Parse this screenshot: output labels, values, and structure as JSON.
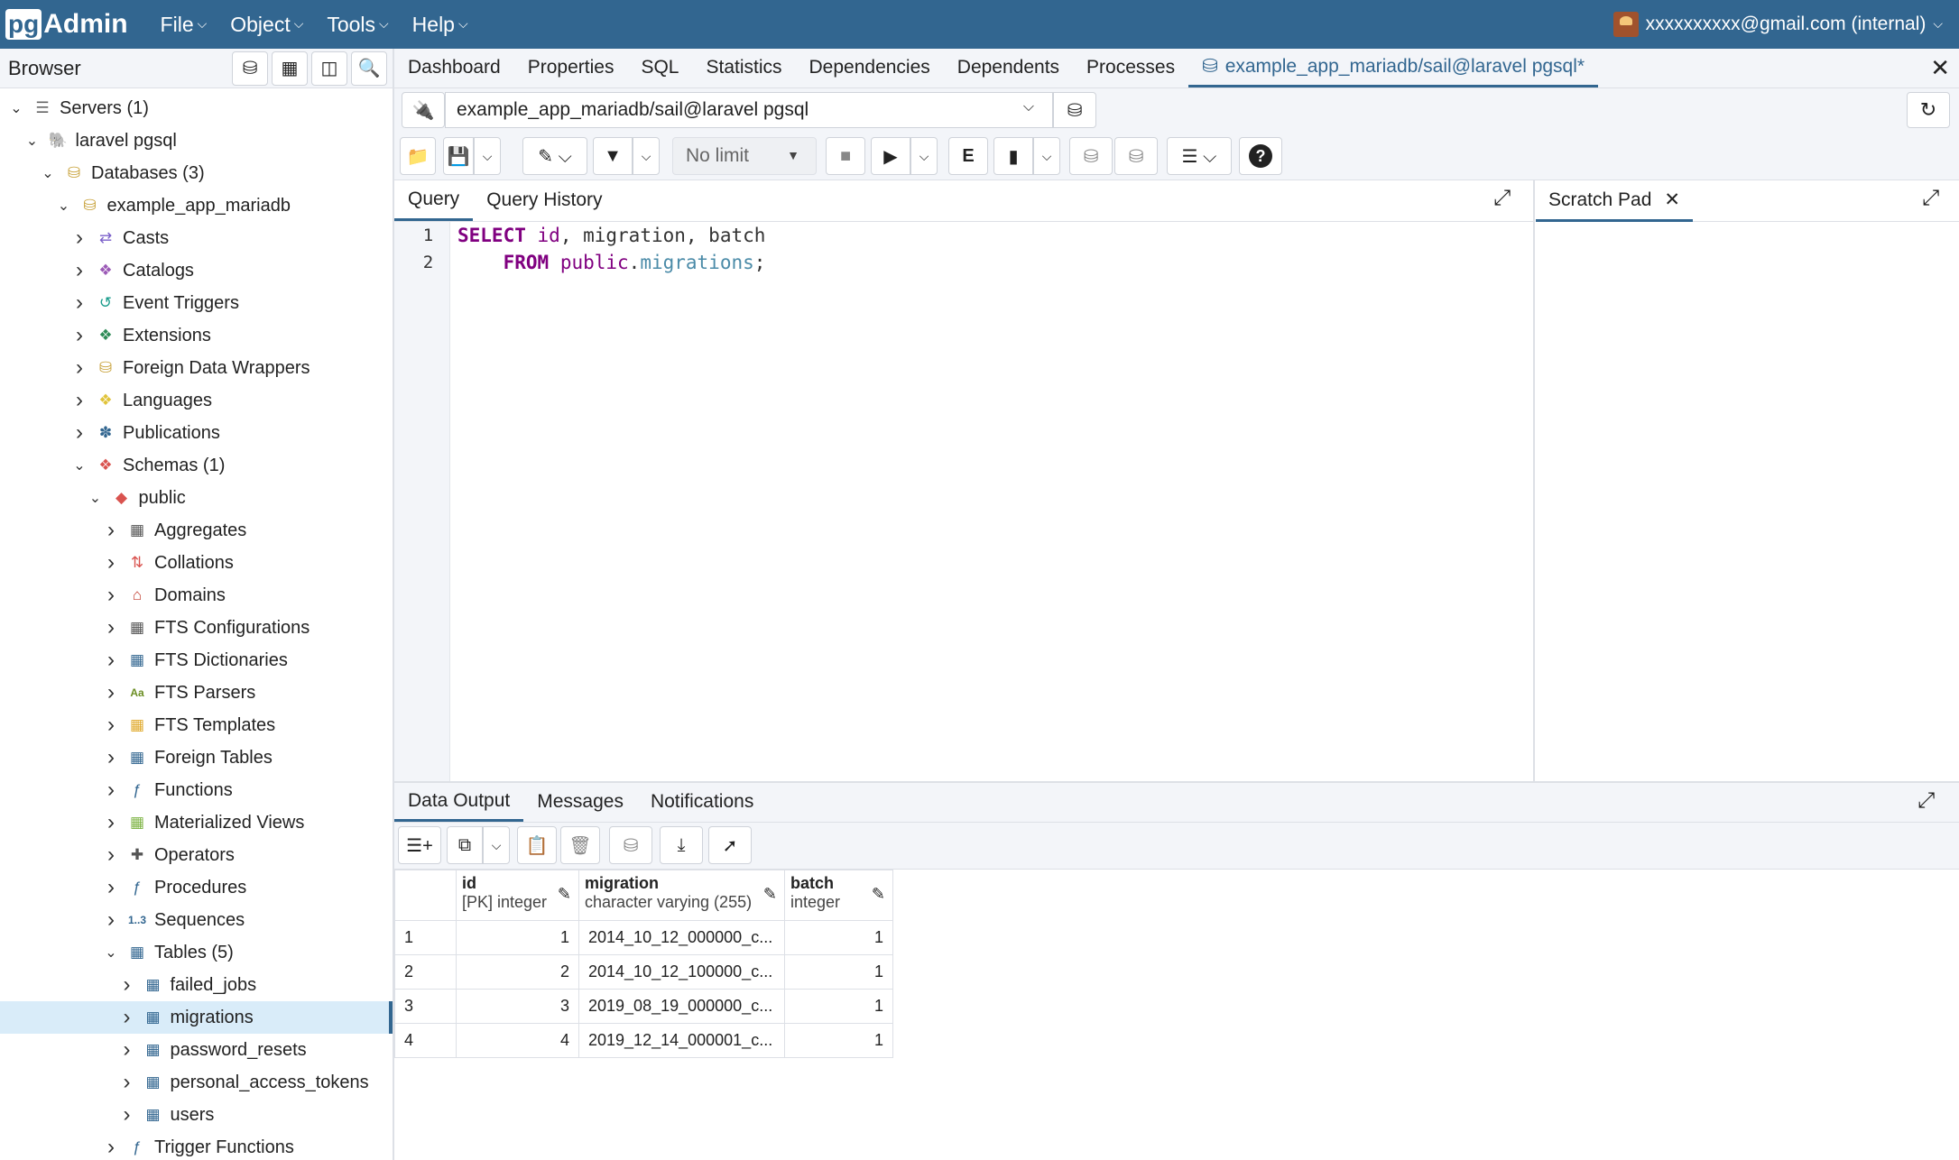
{
  "app": {
    "logo_pg": "pg",
    "logo_admin": "Admin",
    "menu": [
      {
        "label": "File"
      },
      {
        "label": "Object"
      },
      {
        "label": "Tools"
      },
      {
        "label": "Help"
      }
    ],
    "user": "xxxxxxxxxx@gmail.com (internal)"
  },
  "browser": {
    "title": "Browser",
    "tree": [
      {
        "label": "Servers (1)",
        "depth": 0,
        "toggle": "down",
        "icon": "servers-icon"
      },
      {
        "label": "laravel pgsql",
        "depth": 1,
        "toggle": "down",
        "icon": "elephant-icon"
      },
      {
        "label": "Databases (3)",
        "depth": 2,
        "toggle": "down",
        "icon": "databases-icon"
      },
      {
        "label": "example_app_mariadb",
        "depth": 3,
        "toggle": "down",
        "icon": "database-icon"
      },
      {
        "label": "Casts",
        "depth": 4,
        "toggle": "right",
        "icon": "casts-icon"
      },
      {
        "label": "Catalogs",
        "depth": 4,
        "toggle": "right",
        "icon": "catalogs-icon"
      },
      {
        "label": "Event Triggers",
        "depth": 4,
        "toggle": "right",
        "icon": "event-triggers-icon"
      },
      {
        "label": "Extensions",
        "depth": 4,
        "toggle": "right",
        "icon": "extensions-icon"
      },
      {
        "label": "Foreign Data Wrappers",
        "depth": 4,
        "toggle": "right",
        "icon": "fdw-icon"
      },
      {
        "label": "Languages",
        "depth": 4,
        "toggle": "right",
        "icon": "languages-icon"
      },
      {
        "label": "Publications",
        "depth": 4,
        "toggle": "right",
        "icon": "publications-icon"
      },
      {
        "label": "Schemas (1)",
        "depth": 4,
        "toggle": "down",
        "icon": "schemas-icon"
      },
      {
        "label": "public",
        "depth": 5,
        "toggle": "down",
        "icon": "schema-icon"
      },
      {
        "label": "Aggregates",
        "depth": 6,
        "toggle": "right",
        "icon": "aggregates-icon"
      },
      {
        "label": "Collations",
        "depth": 6,
        "toggle": "right",
        "icon": "collations-icon"
      },
      {
        "label": "Domains",
        "depth": 6,
        "toggle": "right",
        "icon": "domains-icon"
      },
      {
        "label": "FTS Configurations",
        "depth": 6,
        "toggle": "right",
        "icon": "fts-config-icon"
      },
      {
        "label": "FTS Dictionaries",
        "depth": 6,
        "toggle": "right",
        "icon": "fts-dict-icon"
      },
      {
        "label": "FTS Parsers",
        "depth": 6,
        "toggle": "right",
        "icon": "fts-parser-icon"
      },
      {
        "label": "FTS Templates",
        "depth": 6,
        "toggle": "right",
        "icon": "fts-template-icon"
      },
      {
        "label": "Foreign Tables",
        "depth": 6,
        "toggle": "right",
        "icon": "foreign-tables-icon"
      },
      {
        "label": "Functions",
        "depth": 6,
        "toggle": "right",
        "icon": "functions-icon"
      },
      {
        "label": "Materialized Views",
        "depth": 6,
        "toggle": "right",
        "icon": "mviews-icon"
      },
      {
        "label": "Operators",
        "depth": 6,
        "toggle": "right",
        "icon": "operators-icon"
      },
      {
        "label": "Procedures",
        "depth": 6,
        "toggle": "right",
        "icon": "procedures-icon"
      },
      {
        "label": "Sequences",
        "depth": 6,
        "toggle": "right",
        "icon": "sequences-icon"
      },
      {
        "label": "Tables (5)",
        "depth": 6,
        "toggle": "down",
        "icon": "tables-icon"
      },
      {
        "label": "failed_jobs",
        "depth": 7,
        "toggle": "right",
        "icon": "table-icon"
      },
      {
        "label": "migrations",
        "depth": 7,
        "toggle": "right",
        "icon": "table-icon",
        "selected": true
      },
      {
        "label": "password_resets",
        "depth": 7,
        "toggle": "right",
        "icon": "table-icon"
      },
      {
        "label": "personal_access_tokens",
        "depth": 7,
        "toggle": "right",
        "icon": "table-icon"
      },
      {
        "label": "users",
        "depth": 7,
        "toggle": "right",
        "icon": "table-icon"
      },
      {
        "label": "Trigger Functions",
        "depth": 6,
        "toggle": "right",
        "icon": "trigger-functions-icon"
      }
    ]
  },
  "tabs": {
    "items": [
      "Dashboard",
      "Properties",
      "SQL",
      "Statistics",
      "Dependencies",
      "Dependents",
      "Processes"
    ],
    "active": "example_app_mariadb/sail@laravel pgsql*"
  },
  "connection": {
    "value": "example_app_mariadb/sail@laravel pgsql"
  },
  "toolbar": {
    "limit": "No limit"
  },
  "query": {
    "tab_query": "Query",
    "tab_history": "Query History",
    "lines": [
      "1",
      "2"
    ]
  },
  "scratch": {
    "title": "Scratch Pad"
  },
  "output": {
    "tabs": [
      "Data Output",
      "Messages",
      "Notifications"
    ],
    "columns": [
      {
        "name": "id",
        "type": "[PK] integer"
      },
      {
        "name": "migration",
        "type": "character varying (255)"
      },
      {
        "name": "batch",
        "type": "integer"
      }
    ],
    "rows": [
      {
        "n": "1",
        "id": "1",
        "migration": "2014_10_12_000000_c...",
        "batch": "1"
      },
      {
        "n": "2",
        "id": "2",
        "migration": "2014_10_12_100000_c...",
        "batch": "1"
      },
      {
        "n": "3",
        "id": "3",
        "migration": "2019_08_19_000000_c...",
        "batch": "1"
      },
      {
        "n": "4",
        "id": "4",
        "migration": "2019_12_14_000001_c...",
        "batch": "1"
      }
    ]
  },
  "colors": {
    "brand": "#326690",
    "selected_row": "#d9ecf9",
    "keyword": "#800080"
  }
}
